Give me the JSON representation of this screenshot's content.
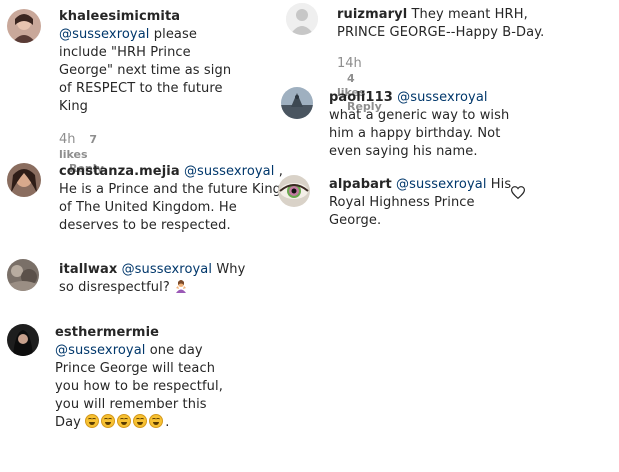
{
  "comments": [
    {
      "username": "khaleesimicmita",
      "mention": "@sussexroyal",
      "lines": [
        "please",
        "include \"HRH Prince",
        "George\" next time as sign",
        "of RESPECT to the future",
        "King"
      ],
      "time": "4h",
      "likes": "7 likes",
      "reply": "Reply",
      "avatar_icon": "avatar-photo"
    },
    {
      "username": "constanza.mejia",
      "mention": "@sussexroyal",
      "lines": [
        ",",
        "He is a Prince and the future King",
        "of The United Kingdom. He",
        "deserves to be respected."
      ],
      "avatar_icon": "avatar-photo"
    },
    {
      "username": "itallwax",
      "mention": "@sussexroyal",
      "lines": [
        "Why",
        "so disrespectful?"
      ],
      "emoji": "person-gesturing-icon",
      "avatar_icon": "avatar-photo"
    },
    {
      "username": "esthermermie",
      "mention": "@sussexroyal",
      "lines": [
        "one day",
        "Prince George will teach",
        "you how to be respectful,",
        "you will remember this",
        "Day"
      ],
      "trailing": ".",
      "emoji": "grinning-squinting-face-icon",
      "avatar_icon": "avatar-photo"
    },
    {
      "username": "ruizmaryl",
      "lines": [
        "They meant HRH,",
        "PRINCE GEORGE--Happy B-Day."
      ],
      "time": "14h",
      "likes": "4 likes",
      "reply": "Reply",
      "avatar_icon": "avatar-placeholder"
    },
    {
      "username": "paoli113",
      "mention": "@sussexroyal",
      "lines": [
        "what a generic way to wish",
        "him a happy birthday. Not",
        "even saying his name."
      ],
      "avatar_icon": "avatar-photo"
    },
    {
      "username": "alpabart",
      "mention": "@sussexroyal",
      "lines": [
        "His",
        "Royal Highness Prince",
        "George."
      ],
      "like_icon": "heart-icon",
      "avatar_icon": "avatar-eye-photo"
    }
  ],
  "colors": {
    "text": "#262626",
    "mention": "#00376b",
    "meta": "#8e8e8e"
  }
}
